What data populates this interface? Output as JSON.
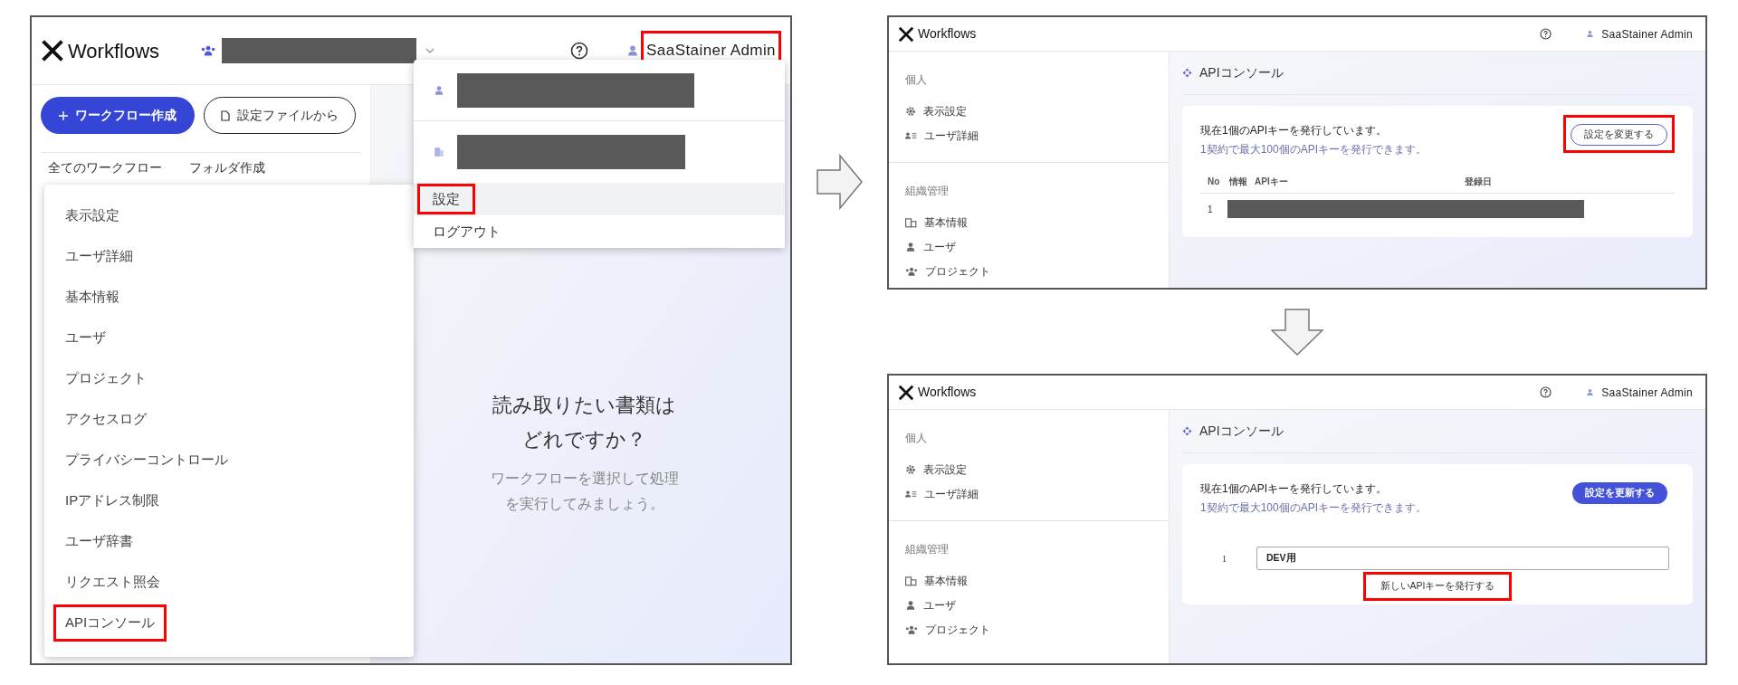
{
  "screen_1": {
    "header": {
      "logo": "Workflows",
      "user_name": {
        "text": "SaaStainer Admin",
        "highlighted": true
      }
    },
    "sidebar": {
      "buttons": [
        {
          "label": "ワークフロー作成",
          "kind": "primary"
        },
        {
          "label": "設定ファイルから",
          "kind": "outline"
        }
      ],
      "list_header": {
        "title": "全てのワークフロー",
        "folder_action": "フォルダ作成"
      }
    },
    "settings_menu": {
      "items": [
        {
          "label": "表示設定",
          "highlighted": false
        },
        {
          "label": "ユーザ詳細",
          "highlighted": false
        },
        {
          "label": "基本情報",
          "highlighted": false
        },
        {
          "label": "ユーザ",
          "highlighted": false
        },
        {
          "label": "プロジェクト",
          "highlighted": false
        },
        {
          "label": "アクセスログ",
          "highlighted": false
        },
        {
          "label": "プライバシーコントロール",
          "highlighted": false
        },
        {
          "label": "IPアドレス制限",
          "highlighted": false
        },
        {
          "label": "ユーザ辞書",
          "highlighted": false
        },
        {
          "label": "リクエスト照会",
          "highlighted": false
        },
        {
          "label": "APIコンソール",
          "highlighted": true
        }
      ]
    },
    "account_menu": {
      "items": [
        {
          "kind": "user"
        },
        {
          "kind": "organization"
        },
        {
          "kind": "link",
          "label": "設定",
          "selected": true,
          "highlighted": true
        },
        {
          "kind": "link",
          "label": "ログアウト",
          "selected": false,
          "highlighted": false
        }
      ]
    },
    "empty_state": {
      "heading_lines": [
        "読み取りたい書類は",
        "どれですか？"
      ],
      "hint_lines": [
        "ワークフローを選択して処理",
        "を実行してみましょう。"
      ]
    }
  },
  "screen_2": {
    "header": {
      "logo": "Workflows",
      "user_name": "SaaStainer Admin"
    },
    "sidebar": {
      "sections": [
        {
          "title": "個人",
          "items": [
            {
              "label": "表示設定",
              "kind": "gear"
            },
            {
              "label": "ユーザ詳細",
              "kind": "user-list"
            }
          ]
        },
        {
          "title": "組織管理",
          "items": [
            {
              "label": "基本情報",
              "kind": "building"
            },
            {
              "label": "ユーザ",
              "kind": "user"
            },
            {
              "label": "プロジェクト",
              "kind": "users"
            }
          ]
        }
      ]
    },
    "page_title": "APIコンソール",
    "card": {
      "summary": "現在1個のAPIキーを発行しています。",
      "note": "1契約で最大100個のAPIキーを発行できます。",
      "action": {
        "label": "設定を変更する",
        "kind": "outline",
        "highlighted": true
      },
      "table": {
        "columns": [
          "No",
          "情報",
          "APIキー",
          "登録日"
        ],
        "rows": [
          {
            "no": "1"
          }
        ]
      }
    }
  },
  "screen_3": {
    "header": {
      "logo": "Workflows",
      "user_name": "SaaStainer Admin"
    },
    "sidebar": {
      "sections": [
        {
          "title": "個人",
          "items": [
            {
              "label": "表示設定",
              "kind": "gear"
            },
            {
              "label": "ユーザ詳細",
              "kind": "user-list"
            }
          ]
        },
        {
          "title": "組織管理",
          "items": [
            {
              "label": "基本情報",
              "kind": "building"
            },
            {
              "label": "ユーザ",
              "kind": "user"
            },
            {
              "label": "プロジェクト",
              "kind": "users"
            }
          ]
        }
      ]
    },
    "page_title": "APIコンソール",
    "card": {
      "summary": "現在1個のAPIキーを発行しています。",
      "note": "1契約で最大100個のAPIキーを発行できます。",
      "action": {
        "label": "設定を更新する",
        "kind": "primary",
        "highlighted": false
      },
      "key_rows": [
        {
          "no": "1",
          "value": "DEV用"
        }
      ],
      "issue_button": {
        "label": "新しいAPIキーを発行する",
        "highlighted": true
      }
    }
  }
}
